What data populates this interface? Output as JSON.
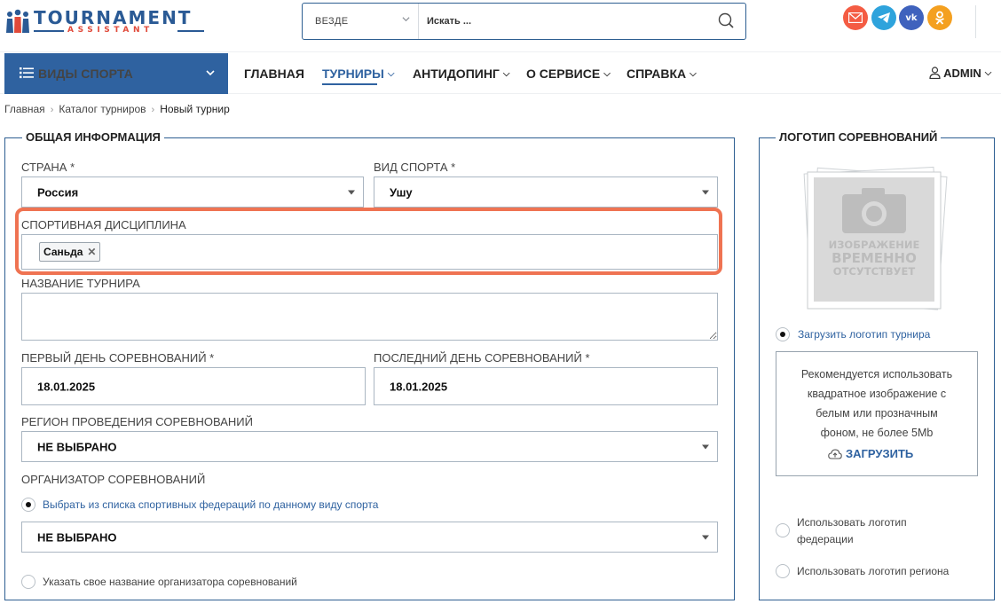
{
  "header": {
    "logo_title": "TOURNAMENT",
    "logo_subtitle": "ASSISTANT",
    "search": {
      "scope": "ВЕЗДЕ",
      "placeholder": "Искать ..."
    },
    "social": [
      {
        "name": "mail-icon",
        "color": "#f45c43"
      },
      {
        "name": "telegram-icon",
        "color": "#2ea3dc"
      },
      {
        "name": "vk-icon",
        "color": "#3f62bd"
      },
      {
        "name": "odnoklassniki-icon",
        "color": "#f4a020"
      }
    ]
  },
  "nav": {
    "sports_label": "ВИДЫ СПОРТА",
    "items": [
      {
        "label": "ГЛАВНАЯ"
      },
      {
        "label": "ТУРНИРЫ"
      },
      {
        "label": "АНТИДОПИНГ"
      },
      {
        "label": "О СЕРВИСЕ"
      },
      {
        "label": "СПРАВКА"
      }
    ],
    "user": "ADMIN"
  },
  "breadcrumb": [
    "Главная",
    "Каталог турниров",
    "Новый турнир"
  ],
  "general": {
    "legend": "ОБЩАЯ ИНФОРМАЦИЯ",
    "country_label": "СТРАНА",
    "country_value": "Россия",
    "sport_label": "ВИД СПОРТА",
    "sport_value": "Ушу",
    "discipline_label": "СПОРТИВНАЯ ДИСЦИПЛИНА",
    "discipline_tag": "Саньда",
    "name_label": "НАЗВАНИЕ ТУРНИРА",
    "first_day_label": "ПЕРВЫЙ ДЕНЬ СОРЕВНОВАНИЙ",
    "first_day_value": "18.01.2025",
    "last_day_label": "ПОСЛЕДНИЙ ДЕНЬ СОРЕВНОВАНИЙ",
    "last_day_value": "18.01.2025",
    "region_label": "РЕГИОН ПРОВЕДЕНИЯ СОРЕВНОВАНИЙ",
    "region_value": "НЕ ВЫБРАНО",
    "organizer_label": "ОРГАНИЗАТОР СОРЕВНОВАНИЙ",
    "organizer_option1": "Выбрать из списка спортивных федераций по данному виду спорта",
    "organizer_value": "НЕ ВЫБРАНО",
    "organizer_option2": "Указать свое название организатора соревнований",
    "required_mark": "*"
  },
  "logo_panel": {
    "legend": "ЛОГОТИП СОРЕВНОВАНИЙ",
    "placeholder_lines": [
      "ИЗОБРАЖЕНИЕ",
      "ВРЕМЕННО",
      "ОТСУТСТВУЕТ"
    ],
    "option_upload": "Загрузить логотип турнира",
    "recommend_lines": [
      "Рекомендуется использовать",
      "квадратное изображение с",
      "белым или прозначным",
      "фоном, не более 5Mb"
    ],
    "upload_label": "ЗАГРУЗИТЬ",
    "option_federation_lines": [
      "Использовать логотип",
      "федерации"
    ],
    "option_region": "Использовать логотип региона"
  },
  "colors": {
    "brand_blue": "#2f62a0",
    "highlight": "#ef7352",
    "logo_red": "#e04a3a"
  }
}
